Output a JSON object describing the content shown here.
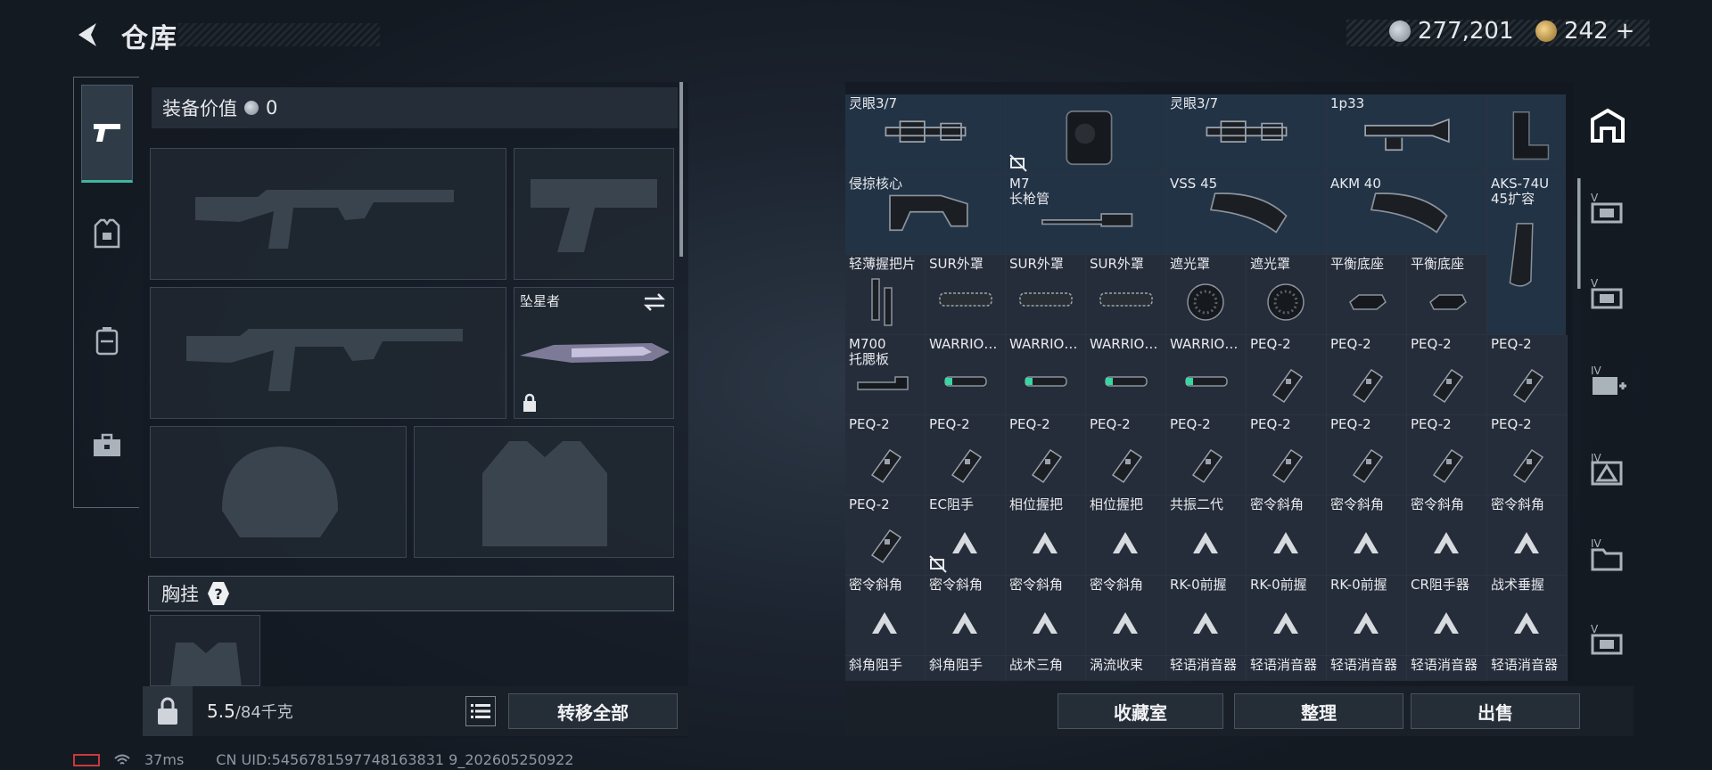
{
  "header": {
    "title": "仓库",
    "silver_amount": "277,201",
    "gold_amount": "242",
    "gold_add": "+"
  },
  "loadout": {
    "value_label": "装备价值",
    "value": "0",
    "melee_name": "坠星者",
    "chest_rig_label": "胸挂",
    "chest_rig_help": "?",
    "weight_current": "5.5",
    "weight_max": "/84千克",
    "transfer_all": "转移全部"
  },
  "stash": {
    "rows": [
      [
        {
          "n": "灵眼3/7",
          "icon": "scope"
        },
        {
          "n": "",
          "icon": "box",
          "ribbon": true
        },
        {
          "n": "灵眼3/7",
          "icon": "scope"
        },
        {
          "n": "1p33",
          "icon": "scope2"
        },
        {
          "n": "",
          "icon": "mount"
        }
      ],
      [
        {
          "n": "侵掠核心",
          "icon": "stock"
        },
        {
          "n": "M7\n长枪管",
          "icon": "barrel"
        },
        {
          "n": "VSS 45",
          "icon": "mag"
        },
        {
          "n": "AKM 40",
          "icon": "mag"
        },
        {
          "n": "AKS-74U\n45扩容",
          "icon": "mag-tall"
        }
      ],
      [
        {
          "n": "轻薄握把片",
          "icon": "grip"
        },
        {
          "n": "SUR外罩",
          "icon": "handguard"
        },
        {
          "n": "SUR外罩",
          "icon": "handguard"
        },
        {
          "n": "SUR外罩",
          "icon": "handguard"
        },
        {
          "n": "遮光罩",
          "icon": "hood"
        },
        {
          "n": "遮光罩",
          "icon": "hood"
        },
        {
          "n": "平衡底座",
          "icon": "base"
        },
        {
          "n": "平衡底座",
          "icon": "base"
        }
      ],
      [
        {
          "n": "M700\n托腮板",
          "icon": "cheek"
        },
        {
          "n": "WARRIO…",
          "icon": "light"
        },
        {
          "n": "WARRIO…",
          "icon": "light"
        },
        {
          "n": "WARRIO…",
          "icon": "light"
        },
        {
          "n": "WARRIO…",
          "icon": "light"
        },
        {
          "n": "PEQ-2",
          "icon": "peq"
        },
        {
          "n": "PEQ-2",
          "icon": "peq"
        },
        {
          "n": "PEQ-2",
          "icon": "peq"
        },
        {
          "n": "PEQ-2",
          "icon": "peq"
        }
      ],
      [
        {
          "n": "PEQ-2",
          "icon": "peq"
        },
        {
          "n": "PEQ-2",
          "icon": "peq"
        },
        {
          "n": "PEQ-2",
          "icon": "peq"
        },
        {
          "n": "PEQ-2",
          "icon": "peq"
        },
        {
          "n": "PEQ-2",
          "icon": "peq"
        },
        {
          "n": "PEQ-2",
          "icon": "peq"
        },
        {
          "n": "PEQ-2",
          "icon": "peq"
        },
        {
          "n": "PEQ-2",
          "icon": "peq"
        },
        {
          "n": "PEQ-2",
          "icon": "peq"
        }
      ],
      [
        {
          "n": "PEQ-2",
          "icon": "peq"
        },
        {
          "n": "EC阻手",
          "icon": "tri",
          "ribbon": true
        },
        {
          "n": "相位握把",
          "icon": "tri"
        },
        {
          "n": "相位握把",
          "icon": "tri"
        },
        {
          "n": "共振二代",
          "icon": "tri"
        },
        {
          "n": "密令斜角",
          "icon": "tri"
        },
        {
          "n": "密令斜角",
          "icon": "tri"
        },
        {
          "n": "密令斜角",
          "icon": "tri"
        },
        {
          "n": "密令斜角",
          "icon": "tri"
        }
      ],
      [
        {
          "n": "密令斜角",
          "icon": "tri"
        },
        {
          "n": "密令斜角",
          "icon": "tri"
        },
        {
          "n": "密令斜角",
          "icon": "tri"
        },
        {
          "n": "密令斜角",
          "icon": "tri"
        },
        {
          "n": "RK-0前握",
          "icon": "tri"
        },
        {
          "n": "RK-0前握",
          "icon": "tri"
        },
        {
          "n": "RK-0前握",
          "icon": "tri"
        },
        {
          "n": "CR阻手器",
          "icon": "tri"
        },
        {
          "n": "战术垂握",
          "icon": "tri"
        }
      ],
      [
        {
          "n": "斜角阻手",
          "icon": ""
        },
        {
          "n": "斜角阻手",
          "icon": ""
        },
        {
          "n": "战术三角",
          "icon": ""
        },
        {
          "n": "涡流收束",
          "icon": ""
        },
        {
          "n": "轻语消音器",
          "icon": ""
        },
        {
          "n": "轻语消音器",
          "icon": ""
        },
        {
          "n": "轻语消音器",
          "icon": ""
        },
        {
          "n": "轻语消音器",
          "icon": ""
        },
        {
          "n": "轻语消音器",
          "icon": ""
        }
      ]
    ]
  },
  "actions": {
    "collection": "收藏室",
    "organize": "整理",
    "sell": "出售"
  },
  "status": {
    "ping": "37ms",
    "uid": "CN UID:5456781597748163831 9_202605250922"
  }
}
